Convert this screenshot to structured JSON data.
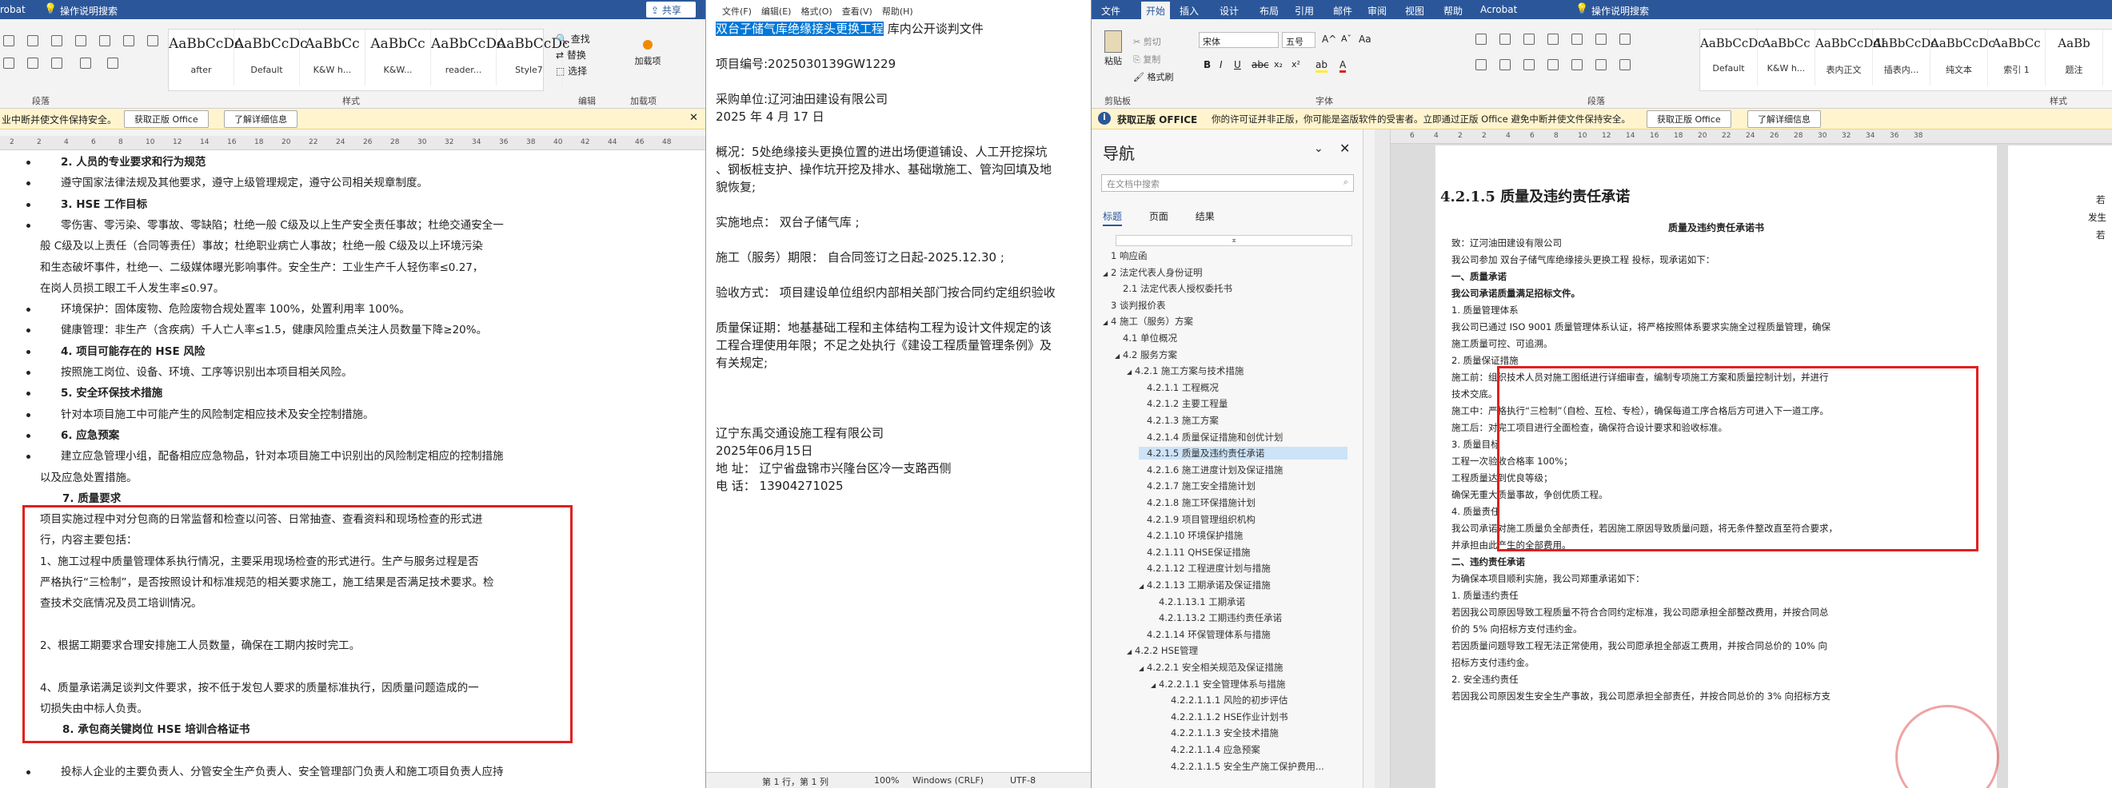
{
  "left": {
    "title_fragment": "robat",
    "tell_me": "操作说明搜索",
    "share": "共享",
    "styles": [
      {
        "sample": "AaBbCcDc",
        "name": "after"
      },
      {
        "sample": "AaBbCcDc",
        "name": "Default"
      },
      {
        "sample": "AaBbCc",
        "name": "K&W h..."
      },
      {
        "sample": "AaBbCc",
        "name": "K&W..."
      },
      {
        "sample": "AaBbCcDc",
        "name": "reader..."
      },
      {
        "sample": "AaBbCcDc",
        "name": "Style7"
      }
    ],
    "edit": {
      "find": "查找",
      "replace": "替换",
      "select": "选择"
    },
    "addin_label": "加载项",
    "groups": {
      "paragraph": "段落",
      "styles": "样式",
      "edit": "编辑",
      "addins": "加载项"
    },
    "msg": {
      "text": "业中断并使文件保持安全。",
      "btn1": "获取正版 Office",
      "btn2": "了解详细信息"
    },
    "ruler_nums": [
      "2",
      "2",
      "4",
      "6",
      "8",
      "10",
      "12",
      "14",
      "16",
      "18",
      "20",
      "22",
      "24",
      "26",
      "28",
      "30",
      "32",
      "34",
      "36",
      "38",
      "40",
      "42",
      "44",
      "46",
      "48"
    ],
    "lines": [
      {
        "t": "2. 人员的专业要求和行为规范",
        "h": true,
        "b": true
      },
      {
        "t": "遵守国家法律法规及其他要求，遵守上级管理规定，遵守公司相关规章制度。",
        "b": true
      },
      {
        "t": "3. HSE 工作目标",
        "h": true,
        "b": true
      },
      {
        "t": "零伤害、零污染、零事故、零缺陷；杜绝一般 C级及以上生产安全责任事故；杜绝交通安全一",
        "b": true
      },
      {
        "t": "般 C级及以上责任（合同等责任）事故；杜绝职业病亡人事故；杜绝一般 C级及以上环境污染"
      },
      {
        "t": "和生态破坏事件，杜绝一、二级媒体曝光影响事件。安全生产：工业生产千人轻伤率≤0.27，"
      },
      {
        "t": "在岗人员损工眼工千人发生率≤0.97。"
      },
      {
        "t": "环境保护：固体废物、危险废物合规处置率 100%，处置利用率 100%。",
        "b": true
      },
      {
        "t": "健康管理：非生产（含疾病）千人亡人率≤1.5，健康风险重点关注人员数量下降≥20%。",
        "b": true
      },
      {
        "t": "4. 项目可能存在的 HSE 风险",
        "h": true,
        "b": true
      },
      {
        "t": "按照施工岗位、设备、环境、工序等识别出本项目相关风险。",
        "b": true
      },
      {
        "t": "5. 安全环保技术措施",
        "h": true,
        "b": true
      },
      {
        "t": "针对本项目施工中可能产生的风险制定相应技术及安全控制措施。",
        "b": true
      },
      {
        "t": "6. 应急预案",
        "h": true,
        "b": true
      },
      {
        "t": "建立应急管理小组，配备相应应急物品，针对本项目施工中识别出的风险制定相应的控制措施",
        "b": true
      },
      {
        "t": "以及应急处置措施。"
      },
      {
        "t": "7. 质量要求",
        "h": true
      },
      {
        "t": "项目实施过程中对分包商的日常监督和检查以问答、日常抽查、查看资料和现场检查的形式进"
      },
      {
        "t": "行，内容主要包括："
      },
      {
        "t": "1、施工过程中质量管理体系执行情况，主要采用现场检查的形式进行。生产与服务过程是否"
      },
      {
        "t": "严格执行“三检制”，是否按照设计和标准规范的相关要求施工，施工结果是否满足技术要求。检"
      },
      {
        "t": "查技术交底情况及员工培训情况。"
      },
      {
        "t": ""
      },
      {
        "t": "2、根据工期要求合理安排施工人员数量，确保在工期内按时完工。"
      },
      {
        "t": ""
      },
      {
        "t": "4、质量承诺满足谈判文件要求，按不低于发包人要求的质量标准执行，因质量问题造成的一"
      },
      {
        "t": "切损失由中标人负责。"
      },
      {
        "t": "8. 承包商关键岗位 HSE 培训合格证书",
        "h": true
      },
      {
        "t": ""
      },
      {
        "t": "投标人企业的主要负责人、分管安全生产负责人、安全管理部门负责人和施工项目负责人应持",
        "b": true
      }
    ]
  },
  "notepad": {
    "menu": [
      "文件(F)",
      "编辑(E)",
      "格式(O)",
      "查看(V)",
      "帮助(H)"
    ],
    "lines": [
      {
        "sel": "双台子储气库绝缘接头更换工程",
        "rest": "  库内公开谈判文件"
      },
      {
        "t": ""
      },
      {
        "t": "项目编号:2025030139GW1229"
      },
      {
        "t": ""
      },
      {
        "t": "采购单位:辽河油田建设有限公司"
      },
      {
        "t": " 2025 年 4 月 17 日"
      },
      {
        "t": ""
      },
      {
        "t": "概况：5处绝缘接头更换位置的进出场便道铺设、人工开挖探坑"
      },
      {
        "t": "、钢板桩支护、操作坑开挖及排水、基础墩施工、管沟回填及地"
      },
      {
        "t": "貌恢复;"
      },
      {
        "t": ""
      },
      {
        "t": "实施地点：    双台子储气库                        ;"
      },
      {
        "t": ""
      },
      {
        "t": "施工（服务）期限：    自合同签订之日起-2025.12.30     ;"
      },
      {
        "t": ""
      },
      {
        "t": "验收方式：  项目建设单位组织内部相关部门按合同约定组织验收"
      },
      {
        "t": ""
      },
      {
        "t": "质量保证期：地基基础工程和主体结构工程为设计文件规定的该"
      },
      {
        "t": "工程合理使用年限；不足之处执行《建设工程质量管理条例》及"
      },
      {
        "t": "有关规定;"
      },
      {
        "t": ""
      },
      {
        "t": ""
      },
      {
        "t": ""
      },
      {
        "t": "辽宁东禹交通设施工程有限公司"
      },
      {
        "t": "2025年06月15日"
      },
      {
        "t": "地    址：  辽宁省盘锦市兴隆台区冷一支路西侧"
      },
      {
        "t": "电    话：  13904271025"
      }
    ],
    "status": {
      "pos": "第 1 行，第 1 列",
      "zoom": "100%",
      "eol": "Windows (CRLF)",
      "enc": "UTF-8"
    }
  },
  "right": {
    "tabs": [
      "文件",
      "开始",
      "插入",
      "设计",
      "布局",
      "引用",
      "邮件",
      "审阅",
      "视图",
      "帮助",
      "Acrobat"
    ],
    "tell_me": "操作说明搜索",
    "clipboard": {
      "paste": "粘贴",
      "cut": "剪切",
      "copy": "复制",
      "format": "格式刷"
    },
    "font": {
      "name": "宋体",
      "size": "五号"
    },
    "styles": [
      {
        "sample": "AaBbCcDc",
        "name": "Default"
      },
      {
        "sample": "AaBbCc",
        "name": "K&W h..."
      },
      {
        "sample": "AaBbCcDdI",
        "name": "表内正文"
      },
      {
        "sample": "AaBbCcDc",
        "name": "插表内..."
      },
      {
        "sample": "AaBbCcDc",
        "name": "纯文本"
      },
      {
        "sample": "AaBbCc",
        "name": "索引 1"
      },
      {
        "sample": "AaBb",
        "name": "题注"
      }
    ],
    "groups": {
      "clipboard": "剪贴板",
      "font": "字体",
      "paragraph": "段落",
      "styles": "样式"
    },
    "msg": {
      "title": "获取正版 OFFICE",
      "text": "你的许可证并非正版，你可能是盗版软件的受害者。立即通过正版 Office 避免中断并使文件保持安全。",
      "btn1": "获取正版 Office",
      "btn2": "了解详细信息"
    },
    "nav": {
      "title": "导航",
      "search_placeholder": "在文档中搜索",
      "tabs": [
        "标题",
        "页面",
        "结果"
      ],
      "items": [
        {
          "t": "1 响应函",
          "l": 0
        },
        {
          "t": "2 法定代表人身份证明",
          "l": 0,
          "c": true
        },
        {
          "t": "2.1 法定代表人授权委托书",
          "l": 1
        },
        {
          "t": "3 谈判报价表",
          "l": 0
        },
        {
          "t": "4 施工（服务）方案",
          "l": 0,
          "c": true
        },
        {
          "t": "4.1 单位概况",
          "l": 1
        },
        {
          "t": "4.2 服务方案",
          "l": 1,
          "c": true
        },
        {
          "t": "4.2.1 施工方案与技术措施",
          "l": 2,
          "c": true
        },
        {
          "t": "4.2.1.1 工程概况",
          "l": 3
        },
        {
          "t": "4.2.1.2 主要工程量",
          "l": 3
        },
        {
          "t": "4.2.1.3 施工方案",
          "l": 3
        },
        {
          "t": "4.2.1.4 质量保证措施和创优计划",
          "l": 3
        },
        {
          "t": "4.2.1.5 质量及违约责任承诺",
          "l": 3,
          "sel": true
        },
        {
          "t": "4.2.1.6 施工进度计划及保证措施",
          "l": 3
        },
        {
          "t": "4.2.1.7 施工安全措施计划",
          "l": 3
        },
        {
          "t": "4.2.1.8 施工环保措施计划",
          "l": 3
        },
        {
          "t": "4.2.1.9 项目管理组织机构",
          "l": 3
        },
        {
          "t": "4.2.1.10 环境保护措施",
          "l": 3
        },
        {
          "t": "4.2.1.11 QHSE保证措施",
          "l": 3
        },
        {
          "t": "4.2.1.12 工程进度计划与措施",
          "l": 3
        },
        {
          "t": "4.2.1.13 工期承诺及保证措施",
          "l": 3,
          "c": true
        },
        {
          "t": "4.2.1.13.1 工期承诺",
          "l": 4
        },
        {
          "t": "4.2.1.13.2 工期违约责任承诺",
          "l": 4
        },
        {
          "t": "4.2.1.14 环保管理体系与措施",
          "l": 3
        },
        {
          "t": "4.2.2 HSE管理",
          "l": 2,
          "c": true
        },
        {
          "t": "4.2.2.1 安全相关规范及保证措施",
          "l": 3,
          "c": true
        },
        {
          "t": "4.2.2.1.1 安全管理体系与措施",
          "l": 4,
          "c": true
        },
        {
          "t": "4.2.2.1.1.1 风险的初步评估",
          "l": 5
        },
        {
          "t": "4.2.2.1.1.2 HSE作业计划书",
          "l": 5
        },
        {
          "t": "4.2.2.1.1.3 安全技术措施",
          "l": 5
        },
        {
          "t": "4.2.2.1.1.4 应急预案",
          "l": 5
        },
        {
          "t": "4.2.2.1.1.5 安全生产施工保护费用...",
          "l": 5
        }
      ]
    },
    "ruler_nums": [
      "6",
      "4",
      "2",
      "2",
      "4",
      "6",
      "8",
      "10",
      "12",
      "14",
      "16",
      "18",
      "20",
      "22",
      "24",
      "26",
      "28",
      "30",
      "32",
      "34",
      "36",
      "38"
    ],
    "heading": "4.2.1.5  质量及违约责任承诺",
    "doc_title": "质量及违约责任承诺书",
    "lines": [
      "致：辽河油田建设有限公司",
      "    我公司参加 双台子储气库绝缘接头更换工程 投标，现承诺如下：",
      "    一、质量承诺",
      "    我公司承诺质量满足招标文件。",
      "    1. 质量管理体系",
      "    我公司已通过 ISO 9001 质量管理体系认证，将严格按照体系要求实施全过程质量管理，确保",
      "施工质量可控、可追溯。",
      "    2. 质量保证措施",
      "    施工前：组织技术人员对施工图纸进行详细审查，编制专项施工方案和质量控制计划，并进行",
      "技术交底。",
      "    施工中：严格执行“三检制”（自检、互检、专检），确保每道工序合格后方可进入下一道工序。",
      "    施工后：对完工项目进行全面检查，确保符合设计要求和验收标准。",
      "    3. 质量目标",
      "    工程一次验收合格率 100%；",
      "    工程质量达到优良等级；",
      "    确保无重大质量事故，争创优质工程。",
      "    4. 质量责任",
      "    我公司承诺对施工质量负全部责任，若因施工原因导致质量问题，将无条件整改直至符合要求，",
      "并承担由此产生的全部费用。",
      "    二、违约责任承诺",
      "    为确保本项目顺利实施，我公司郑重承诺如下：",
      "    1. 质量违约责任",
      "    若因我公司原因导致工程质量不符合合同约定标准，我公司愿承担全部整改费用，并按合同总",
      "价的 5% 向招标方支付违约金。",
      "    若因质量问题导致工程无法正常使用，我公司愿承担全部返工费用，并按合同总价的 10% 向",
      "招标方支付违约金。",
      "    2. 安全违约责任",
      "    若因我公司原因发生安全生产事故，我公司愿承担全部责任，并按合同总价的 3% 向招标方支"
    ],
    "edge_text": [
      "若",
      "发生",
      "若"
    ]
  },
  "colors": {
    "ribbon_blue": "#2b579a",
    "accent_red": "#e02020",
    "msg_bg": "#fff4ce"
  }
}
